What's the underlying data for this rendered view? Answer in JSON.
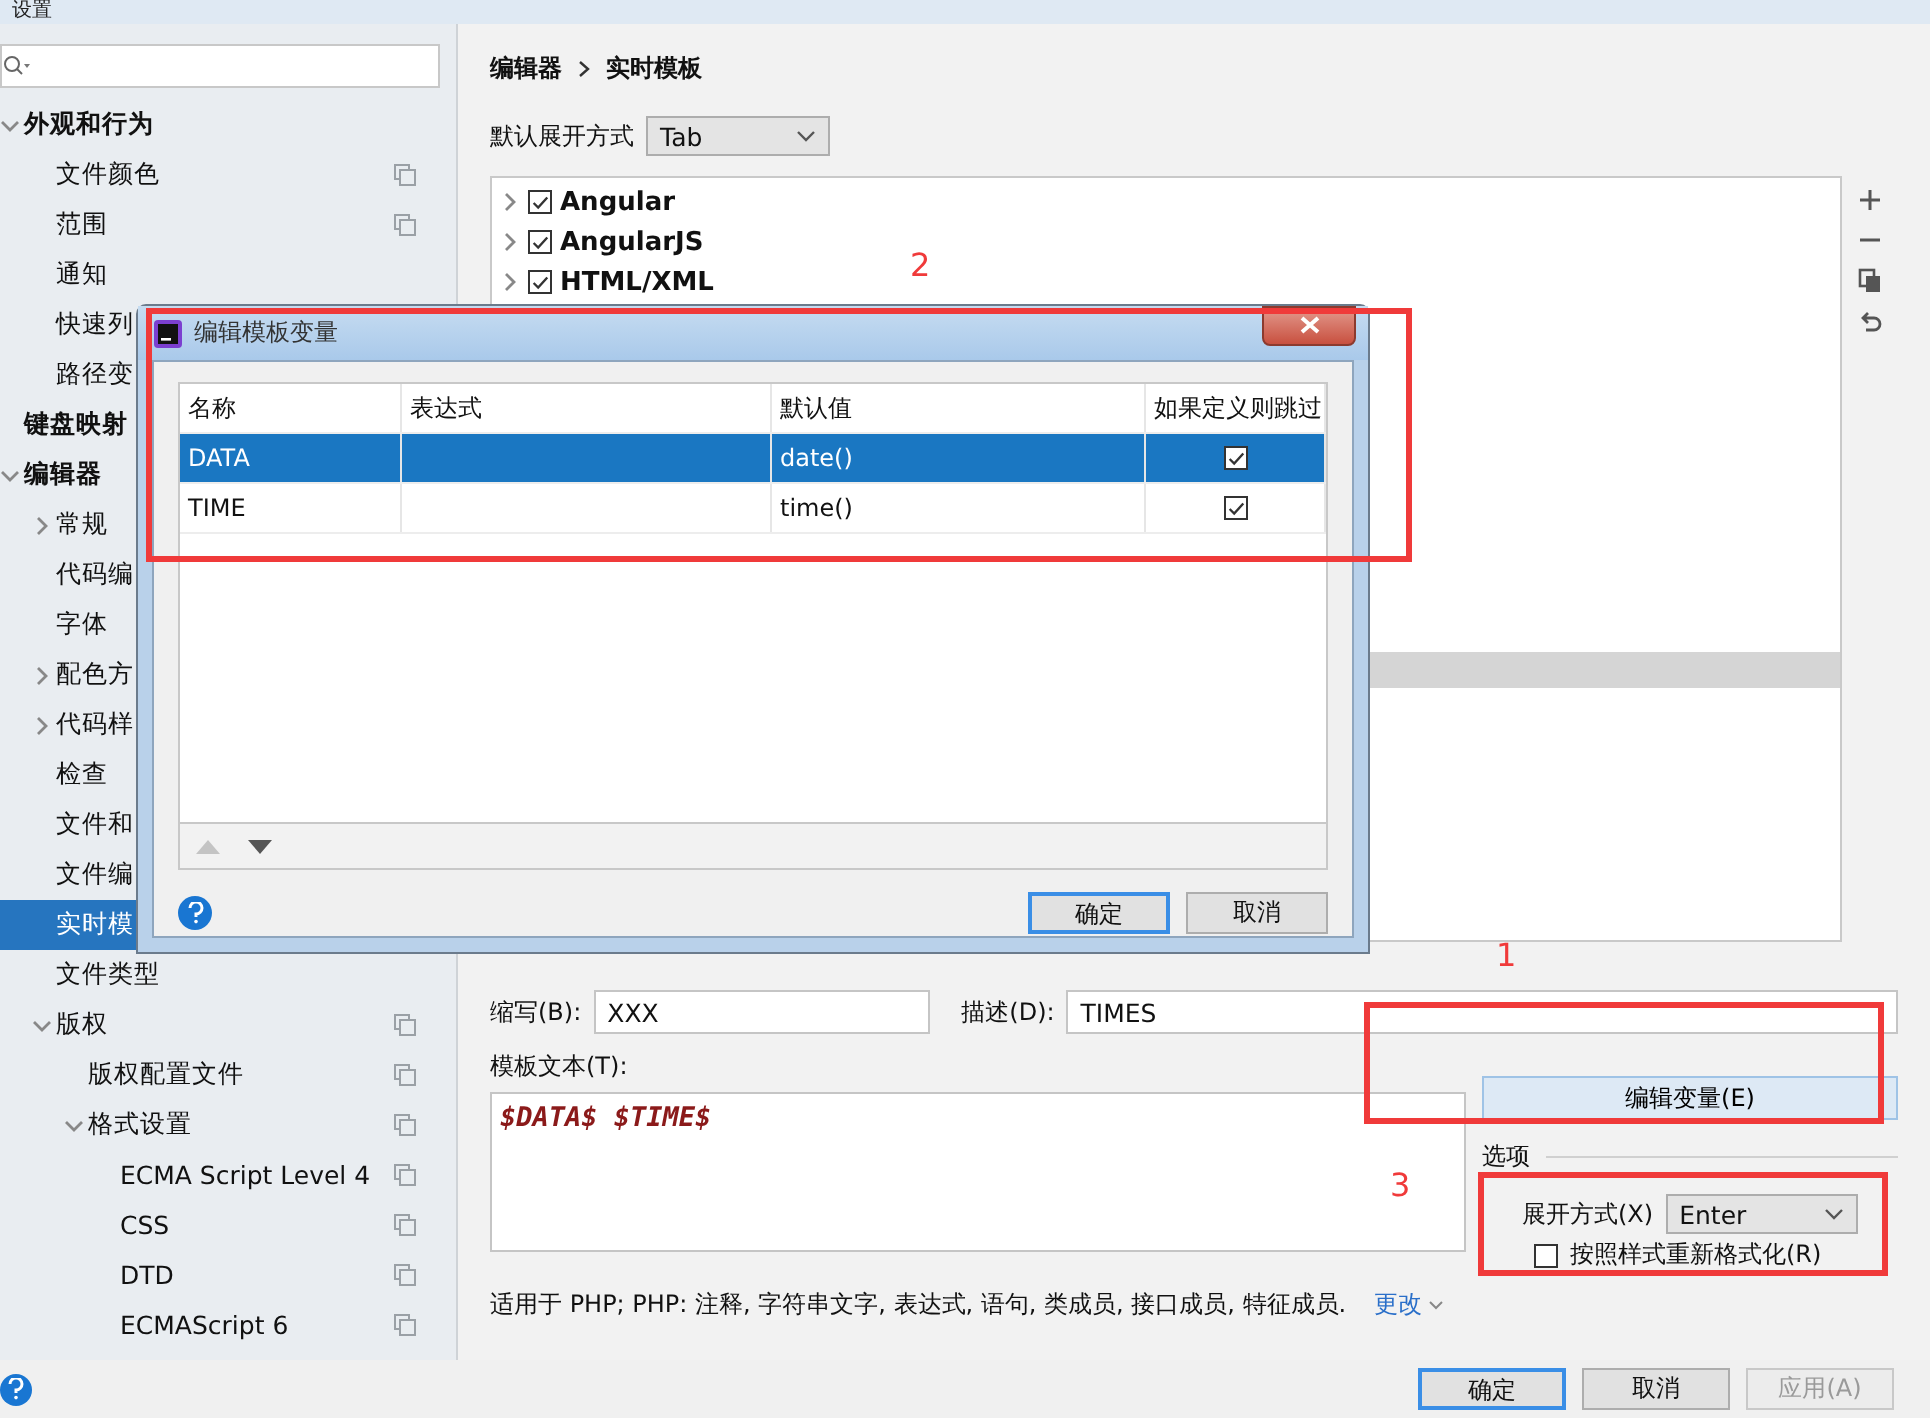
{
  "window": {
    "title": "设置"
  },
  "sidebar": {
    "items": [
      {
        "label": "外观和行为",
        "selected": false,
        "expanded": true,
        "per_project": false,
        "children": [
          {
            "label": "文件颜色",
            "selected": false,
            "per_project": true
          },
          {
            "label": "范围",
            "selected": false,
            "per_project": true
          },
          {
            "label": "通知",
            "selected": false,
            "per_project": false
          },
          {
            "label": "快速列",
            "selected": false,
            "per_project": false
          },
          {
            "label": "路径变",
            "selected": false,
            "per_project": false
          }
        ]
      },
      {
        "label": "键盘映射",
        "selected": false,
        "per_project": false
      },
      {
        "label": "编辑器",
        "selected": false,
        "expanded": true,
        "per_project": false,
        "children": [
          {
            "label": "常规",
            "selected": false,
            "expanded": false,
            "per_project": false
          },
          {
            "label": "代码编",
            "selected": false,
            "per_project": false
          },
          {
            "label": "字体",
            "selected": false,
            "per_project": false
          },
          {
            "label": "配色方",
            "selected": false,
            "expanded": false,
            "per_project": false
          },
          {
            "label": "代码样",
            "selected": false,
            "expanded": false,
            "per_project": false
          },
          {
            "label": "检查",
            "selected": false,
            "per_project": false
          },
          {
            "label": "文件和",
            "selected": false,
            "per_project": false
          },
          {
            "label": "文件编",
            "selected": false,
            "per_project": false
          },
          {
            "label": "实时模",
            "selected": true,
            "per_project": false
          },
          {
            "label": "文件类型",
            "selected": false,
            "per_project": false
          },
          {
            "label": "版权",
            "selected": false,
            "expanded": true,
            "per_project": true,
            "children": [
              {
                "label": "版权配置文件",
                "selected": false,
                "per_project": true
              },
              {
                "label": "格式设置",
                "selected": false,
                "expanded": true,
                "per_project": true,
                "children": [
                  {
                    "label": "ECMA Script Level 4",
                    "selected": false,
                    "per_project": true
                  },
                  {
                    "label": "CSS",
                    "selected": false,
                    "per_project": true
                  },
                  {
                    "label": "DTD",
                    "selected": false,
                    "per_project": true
                  },
                  {
                    "label": "ECMAScript 6",
                    "selected": false,
                    "per_project": true
                  }
                ]
              }
            ]
          }
        ]
      }
    ]
  },
  "breadcrumb": [
    "编辑器",
    "实时模板"
  ],
  "default_expand": {
    "label": "默认展开方式",
    "value": "Tab"
  },
  "template_groups": [
    {
      "label": "Angular",
      "checked": true
    },
    {
      "label": "AngularJS",
      "checked": true
    },
    {
      "label": "HTML/XML",
      "checked": true
    }
  ],
  "abbreviation": {
    "label": "缩写(B):",
    "value": "XXX"
  },
  "description": {
    "label": "描述(D):",
    "value": "TIMES"
  },
  "template_text": {
    "label": "模板文本(T):",
    "value": "$DATA$ $TIME$"
  },
  "edit_variables_button": "编辑变量(E)",
  "options": {
    "title": "选项",
    "expand_with": {
      "label": "展开方式(X)",
      "value": "Enter"
    },
    "reformat": {
      "label": "按照样式重新格式化(R)",
      "checked": false
    }
  },
  "context": {
    "text": "适用于 PHP; PHP: 注释, 字符串文字, 表达式, 语句, 类成员, 接口成员, 特征成员.",
    "link": "更改"
  },
  "buttons": [
    {
      "label": "确定",
      "kind": "default",
      "disabled": false
    },
    {
      "label": "取消",
      "kind": "normal",
      "disabled": false
    },
    {
      "label": "应用(A)",
      "kind": "normal",
      "disabled": true
    }
  ],
  "dialog": {
    "title": "编辑模板变量",
    "columns": [
      "名称",
      "表达式",
      "默认值",
      "如果定义则跳过"
    ],
    "rows": [
      {
        "name": "DATA",
        "default": "date()",
        "skip_if_defined": true,
        "selected": true
      },
      {
        "name": "TIME",
        "default": "time()",
        "skip_if_defined": true,
        "selected": false
      }
    ],
    "buttons": [
      {
        "label": "确定",
        "kind": "default"
      },
      {
        "label": "取消",
        "kind": "normal"
      }
    ]
  },
  "annotations": [
    {
      "label": "2"
    },
    {
      "label": "1"
    },
    {
      "label": "3"
    }
  ]
}
